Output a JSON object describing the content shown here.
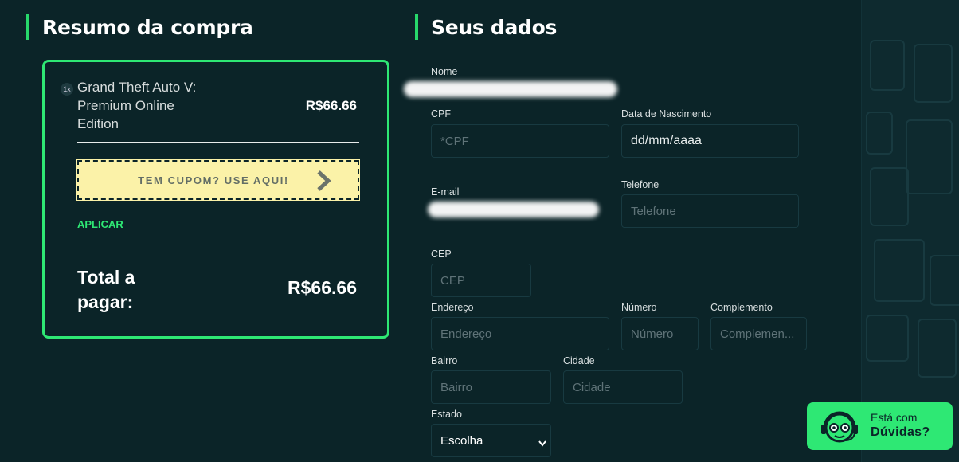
{
  "summary": {
    "title": "Resumo da compra",
    "quantity": "1x",
    "product_name": "Grand Theft Auto V: Premium Online Edition",
    "product_price": "R$66.66",
    "coupon_label": "TEM CUPOM? USE AQUI!",
    "apply_label": "APLICAR",
    "total_label": "Total a pagar:",
    "total_value": "R$66.66"
  },
  "form": {
    "title": "Seus dados",
    "nome_label": "Nome",
    "cpf_label": "CPF",
    "cpf_placeholder": "*CPF",
    "nascimento_label": "Data de Nascimento",
    "nascimento_value": "dd/mm/aaaa",
    "email_label": "E-mail",
    "telefone_label": "Telefone",
    "telefone_placeholder": "Telefone",
    "cep_label": "CEP",
    "cep_placeholder": "CEP",
    "endereco_label": "Endereço",
    "endereco_placeholder": "Endereço",
    "numero_label": "Número",
    "numero_placeholder": "Número",
    "complemento_label": "Complemento",
    "complemento_placeholder": "Complemen...",
    "bairro_label": "Bairro",
    "bairro_placeholder": "Bairro",
    "cidade_label": "Cidade",
    "cidade_placeholder": "Cidade",
    "estado_label": "Estado",
    "estado_selected": "Escolha"
  },
  "help": {
    "line1": "Está com",
    "line2": "Dúvidas?"
  },
  "colors": {
    "background": "#0b2428",
    "accent": "#2ee874",
    "coupon_bg": "#fbf2a8"
  }
}
